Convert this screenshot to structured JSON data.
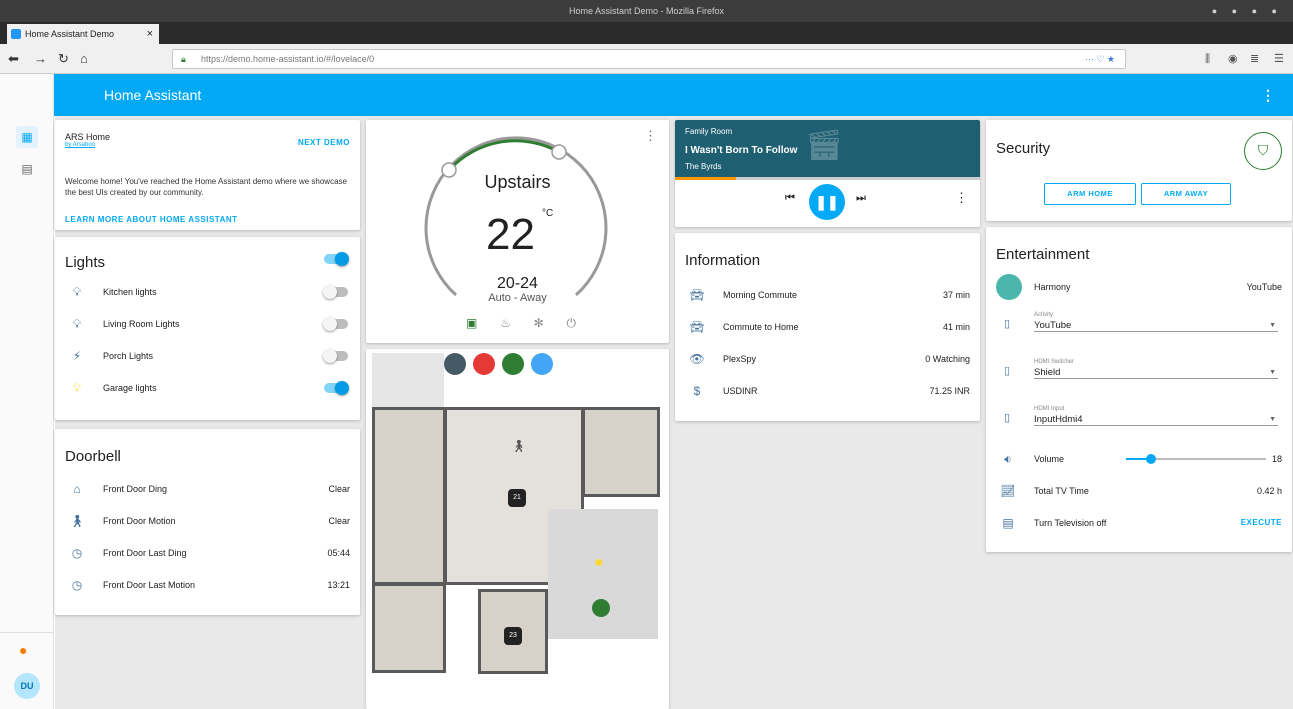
{
  "browser": {
    "window_title": "Home Assistant Demo - Mozilla Firefox",
    "tab_title": "Home Assistant Demo",
    "url": "https://demo.home-assistant.io/#/lovelace/0"
  },
  "app": {
    "title": "Home Assistant",
    "user_initials": "DU"
  },
  "intro": {
    "title": "ARS Home",
    "author": "by Arsaboo",
    "next_label": "NEXT DEMO",
    "text": "Welcome home! You've reached the Home Assistant demo where we showcase the best UIs created by our community.",
    "learn_more": "LEARN MORE ABOUT HOME ASSISTANT"
  },
  "lights": {
    "title": "Lights",
    "master_on": true,
    "items": [
      {
        "name": "Kitchen lights",
        "on": false,
        "icon": "bulb-icon"
      },
      {
        "name": "Living Room Lights",
        "on": false,
        "icon": "bulb-icon"
      },
      {
        "name": "Porch Lights",
        "on": false,
        "icon": "flash-icon"
      },
      {
        "name": "Garage lights",
        "on": true,
        "icon": "bulb-icon"
      }
    ]
  },
  "doorbell": {
    "title": "Doorbell",
    "items": [
      {
        "name": "Front Door Ding",
        "value": "Clear",
        "icon": "home-icon"
      },
      {
        "name": "Front Door Motion",
        "value": "Clear",
        "icon": "walk-icon"
      },
      {
        "name": "Front Door Last Ding",
        "value": "05:44",
        "icon": "history-icon"
      },
      {
        "name": "Front Door Last Motion",
        "value": "13:21",
        "icon": "history-icon"
      }
    ]
  },
  "thermostat": {
    "name": "Upstairs",
    "temp": "22",
    "unit": "°C",
    "range": "20-24",
    "mode": "Auto - Away",
    "accent": "#2e7d32"
  },
  "media": {
    "room": "Family Room",
    "track": "I Wasn't Born To Follow",
    "artist": "The Byrds",
    "bg": "#1f5f72",
    "progress": 0.2
  },
  "info": {
    "title": "Information",
    "items": [
      {
        "name": "Morning Commute",
        "value": "37 min",
        "icon": "car-icon"
      },
      {
        "name": "Commute to Home",
        "value": "41 min",
        "icon": "car-icon"
      },
      {
        "name": "PlexSpy",
        "value": "0 Watching",
        "icon": "eye-icon"
      },
      {
        "name": "USDINR",
        "value": "71.25 INR",
        "icon": "dollar-icon"
      }
    ]
  },
  "security": {
    "title": "Security",
    "arm_home": "ARM HOME",
    "arm_away": "ARM AWAY",
    "accent": "#2e7d32"
  },
  "ent": {
    "title": "Entertainment",
    "harmony": {
      "name": "Harmony",
      "value": "YouTube"
    },
    "activity": {
      "label": "Activity",
      "value": "YouTube"
    },
    "hdmi_switcher": {
      "label": "HDMI Switcher",
      "value": "Shield"
    },
    "hdmi_input": {
      "label": "HDMI Input",
      "value": "InputHdmi4"
    },
    "volume": {
      "label": "Volume",
      "value": "18",
      "level": 0.18
    },
    "tv_time": {
      "label": "Total TV Time",
      "value": "0.42 h"
    },
    "tv_off": {
      "label": "Turn Television off",
      "action": "EXECUTE"
    }
  },
  "floorplan": {
    "badges": [
      "21",
      "23"
    ]
  }
}
